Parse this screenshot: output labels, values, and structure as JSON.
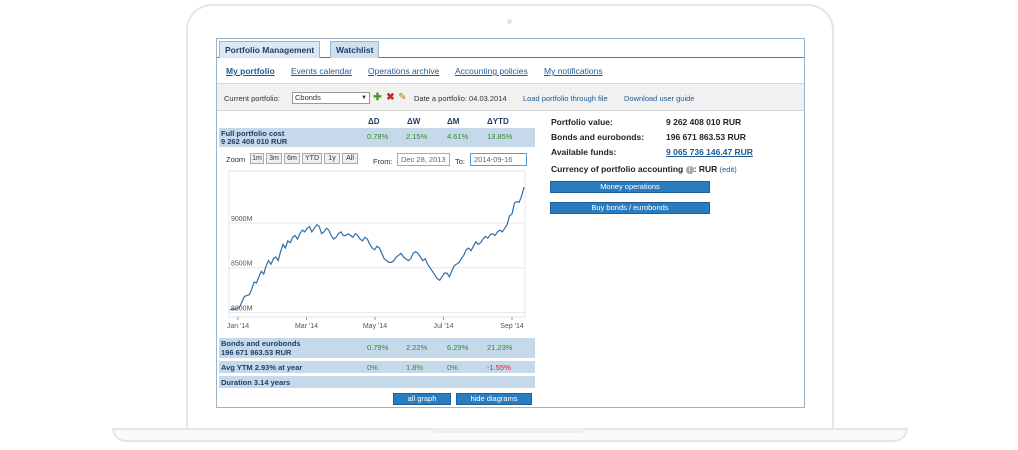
{
  "tabs": [
    {
      "label": "Portfolio Management"
    },
    {
      "label": "Watchlist"
    }
  ],
  "subnav": {
    "my_portfolio": "My portfolio",
    "events_calendar": "Events calendar",
    "operations_archive": "Operations archive",
    "accounting_policies": "Accounting policies",
    "my_notifications": "My notifications"
  },
  "toolbar": {
    "current_portfolio_label": "Current portfolio:",
    "portfolio_selected": "Cbonds",
    "date_label": "Date a portfolio: 04.03.2014",
    "load_link": "Load portfolio through file",
    "guide_link": "Download user guide",
    "icons": [
      "add-icon",
      "delete-icon",
      "edit-icon"
    ]
  },
  "stats": {
    "headers": [
      "ΔD",
      "ΔW",
      "ΔM",
      "ΔYTD"
    ],
    "full_cost": {
      "name": "Full portfolio cost",
      "value": "9 262 408 010 RUR",
      "changes": [
        "0.78%",
        "2.15%",
        "4.61%",
        "13.85%"
      ]
    },
    "bonds": {
      "name": "Bonds and eurobonds",
      "value": "196 671 863.53 RUR",
      "changes": [
        "0.79%",
        "2.22%",
        "6.29%",
        "21.23%"
      ]
    },
    "ytm": {
      "name": "Avg YTM 2.93% at year",
      "changes": [
        "0%",
        "1.8%",
        "0%",
        "-1.55%"
      ]
    },
    "duration": {
      "name": "Duration 3.14 years"
    }
  },
  "zoom": {
    "label": "Zoom",
    "buttons": [
      "1m",
      "3m",
      "6m",
      "YTD",
      "1y",
      "All"
    ],
    "from_label": "From:",
    "from_value": "Dec 28, 2013",
    "to_label": "To:",
    "to_value": "2014-09-16"
  },
  "chart_data": {
    "type": "line",
    "title": "",
    "xlabel": "",
    "ylabel": "",
    "x_ticks": [
      "Jan '14",
      "Mar '14",
      "May '14",
      "Jul '14",
      "Sep '14"
    ],
    "y_ticks": [
      "8000M",
      "8500M",
      "9000M"
    ],
    "ylim": [
      7950,
      9580
    ],
    "grid": true,
    "series": [
      {
        "values": [
          8030,
          8040,
          8030,
          8050,
          8060,
          8120,
          8180,
          8190,
          8200,
          8260,
          8340,
          8330,
          8400,
          8460,
          8430,
          8520,
          8580,
          8540,
          8600,
          8620,
          8580,
          8680,
          8760,
          8720,
          8800,
          8780,
          8840,
          8860,
          8820,
          8880,
          8920,
          8900,
          8940,
          8960,
          8900,
          8940,
          8980,
          8960,
          8880,
          8900,
          8940,
          8920,
          8860,
          8820,
          8840,
          8880,
          8900,
          8860,
          8860,
          8880,
          8860,
          8840,
          8880,
          8860,
          8820,
          8800,
          8840,
          8820,
          8760,
          8720,
          8700,
          8740,
          8720,
          8660,
          8600,
          8580,
          8560,
          8560,
          8580,
          8620,
          8640,
          8660,
          8620,
          8600,
          8580,
          8600,
          8660,
          8680,
          8660,
          8620,
          8580,
          8600,
          8540,
          8500,
          8460,
          8420,
          8380,
          8360,
          8400,
          8440,
          8440,
          8400,
          8460,
          8520,
          8540,
          8560,
          8600,
          8640,
          8700,
          8720,
          8690,
          8740,
          8790,
          8760,
          8780,
          8820,
          8850,
          8830,
          8870,
          8880,
          8860,
          8900,
          8920,
          8900,
          8940,
          8980,
          9080,
          9100,
          9220,
          9240,
          9230,
          9300,
          9400
        ]
      }
    ]
  },
  "bottom_buttons": {
    "all_graph": "all graph",
    "hide_diagrams": "hide diagrams"
  },
  "right_panel": {
    "portfolio_value_label": "Portfolio value:",
    "portfolio_value": "9 262 408 010 RUR",
    "bonds_label": "Bonds and eurobonds:",
    "bonds_value": "196 671 863.53 RUR",
    "funds_label": "Available funds:",
    "funds_value": "9 065 736 146.47 RUR",
    "currency_label": "Currency of portfolio accounting",
    "currency_colon": ":",
    "currency_value": "RUR",
    "edit_link": "(edit)",
    "money_ops_button": "Money operations",
    "buy_bonds_button": "Buy bonds / eurobonds"
  },
  "colors": {
    "accent": "#2b7bbf",
    "stat_row_bg": "#c6d9ea",
    "positive": "#2e8b2e",
    "negative": "#e02020",
    "line": "#2f6ea8"
  }
}
